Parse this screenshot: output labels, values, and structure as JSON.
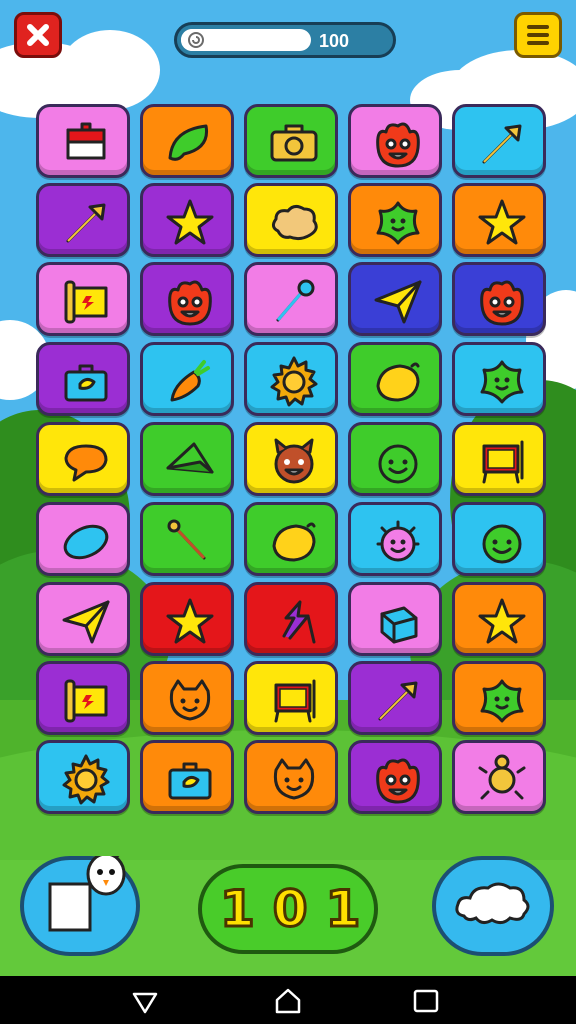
{
  "header": {
    "close_icon": "x-icon",
    "menu_icon": "hamburger-menu-icon",
    "progress": {
      "value_text": "100",
      "fill_fraction": 0.6,
      "icon": "spiral-icon"
    }
  },
  "colors": {
    "pink": "#f27de6",
    "orange": "#ff8a0a",
    "green": "#3fcc2b",
    "cyan": "#2ec3f0",
    "purple": "#9b2ed3",
    "yellow": "#ffe60a",
    "blue": "#3a3fd6",
    "red": "#e4161a",
    "sky": "#4db6ec",
    "grass": "#4fb32c"
  },
  "board": {
    "rows": [
      [
        {
          "color": "pink",
          "icon": "flag-icon"
        },
        {
          "color": "orange",
          "icon": "leaf-icon"
        },
        {
          "color": "green",
          "icon": "camera-icon"
        },
        {
          "color": "pink",
          "icon": "fire-monster-icon"
        },
        {
          "color": "cyan",
          "icon": "arrow-icon"
        }
      ],
      [
        {
          "color": "purple",
          "icon": "arrow-icon"
        },
        {
          "color": "purple",
          "icon": "star-icon"
        },
        {
          "color": "yellow",
          "icon": "cloud-icon"
        },
        {
          "color": "orange",
          "icon": "star-blob-icon"
        },
        {
          "color": "orange",
          "icon": "star-icon"
        }
      ],
      [
        {
          "color": "pink",
          "icon": "banner-icon"
        },
        {
          "color": "purple",
          "icon": "fire-monster-icon"
        },
        {
          "color": "pink",
          "icon": "wand-icon"
        },
        {
          "color": "blue",
          "icon": "paper-plane-icon"
        },
        {
          "color": "blue",
          "icon": "fire-monster-icon"
        }
      ],
      [
        {
          "color": "purple",
          "icon": "briefcase-icon"
        },
        {
          "color": "cyan",
          "icon": "carrot-icon"
        },
        {
          "color": "cyan",
          "icon": "sun-icon"
        },
        {
          "color": "green",
          "icon": "lemon-icon"
        },
        {
          "color": "cyan",
          "icon": "star-blob-icon"
        }
      ],
      [
        {
          "color": "yellow",
          "icon": "speech-bubble-icon"
        },
        {
          "color": "green",
          "icon": "kite-icon"
        },
        {
          "color": "yellow",
          "icon": "devil-face-icon"
        },
        {
          "color": "green",
          "icon": "smiley-face-icon"
        },
        {
          "color": "yellow",
          "icon": "easel-icon"
        }
      ],
      [
        {
          "color": "pink",
          "icon": "disc-icon"
        },
        {
          "color": "green",
          "icon": "brush-icon"
        },
        {
          "color": "green",
          "icon": "lemon-icon"
        },
        {
          "color": "cyan",
          "icon": "spiky-monster-icon"
        },
        {
          "color": "cyan",
          "icon": "smiley-face-icon"
        }
      ],
      [
        {
          "color": "pink",
          "icon": "paper-plane-icon"
        },
        {
          "color": "red",
          "icon": "star-icon"
        },
        {
          "color": "red",
          "icon": "lightning-icon"
        },
        {
          "color": "pink",
          "icon": "cube-icon"
        },
        {
          "color": "orange",
          "icon": "star-icon"
        }
      ],
      [
        {
          "color": "purple",
          "icon": "banner-icon"
        },
        {
          "color": "orange",
          "icon": "cat-face-icon"
        },
        {
          "color": "yellow",
          "icon": "easel-icon"
        },
        {
          "color": "purple",
          "icon": "arrow-icon"
        },
        {
          "color": "orange",
          "icon": "star-blob-icon"
        }
      ],
      [
        {
          "color": "cyan",
          "icon": "sun-icon"
        },
        {
          "color": "orange",
          "icon": "briefcase-icon"
        },
        {
          "color": "orange",
          "icon": "cat-face-icon"
        },
        {
          "color": "purple",
          "icon": "fire-monster-icon"
        },
        {
          "color": "pink",
          "icon": "turtle-icon"
        }
      ]
    ]
  },
  "bottom": {
    "left_button_icon": "note-with-mascot-icon",
    "center_label": "101",
    "right_button_icon": "cloud-icon"
  },
  "navbar": {
    "back_icon": "back-triangle-icon",
    "home_icon": "home-icon",
    "recent_icon": "recent-square-icon"
  }
}
